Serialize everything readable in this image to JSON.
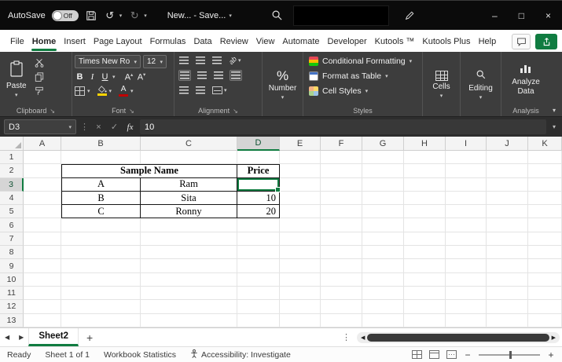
{
  "glyphs": {
    "chevron_down": "▾",
    "tri_up": "▴",
    "launcher": "↘",
    "undo": "↺",
    "redo": "↻",
    "minimize": "–",
    "maximize": "□",
    "close": "×",
    "dots_vertical": "⋮",
    "cancel": "×",
    "check": "✓",
    "fx": "fx",
    "prev": "◀",
    "next": "▶",
    "add": "+",
    "percent": "%",
    "bold": "B",
    "italic": "I",
    "underline": "U",
    "font_a": "A",
    "ab": "ab",
    "minus": "−",
    "plus": "+"
  },
  "titlebar": {
    "autosave_label": "AutoSave",
    "autosave_state": "Off",
    "filename": "New... - Save..."
  },
  "tabs": {
    "items": [
      "File",
      "Home",
      "Insert",
      "Page Layout",
      "Formulas",
      "Data",
      "Review",
      "View",
      "Automate",
      "Developer",
      "Kutools ™",
      "Kutools Plus",
      "Help"
    ],
    "active": "Home"
  },
  "ribbon": {
    "clipboard": {
      "paste_label": "Paste",
      "group_label": "Clipboard"
    },
    "font": {
      "name": "Times New Ro",
      "size": "12",
      "group_label": "Font"
    },
    "alignment": {
      "group_label": "Alignment"
    },
    "number": {
      "label": "Number"
    },
    "styles": {
      "conditional": "Conditional Formatting",
      "format_table": "Format as Table",
      "cell_styles": "Cell Styles",
      "group_label": "Styles"
    },
    "cells": {
      "label": "Cells"
    },
    "editing": {
      "label": "Editing"
    },
    "analysis": {
      "button_label": "Analyze Data",
      "group_label": "Analysis"
    }
  },
  "formula_bar": {
    "name_box": "D3",
    "value": "10"
  },
  "grid": {
    "columns": [
      "A",
      "B",
      "C",
      "D",
      "E",
      "F",
      "G",
      "H",
      "I",
      "J",
      "K"
    ],
    "rows": [
      1,
      2,
      3,
      4,
      5,
      6,
      7,
      8,
      9,
      10,
      11,
      12,
      13
    ],
    "selected_column": "D",
    "selected_row": 3,
    "active_cell": "D3",
    "cells": {
      "B2": {
        "v": "Sample Name",
        "bold": true,
        "merge": 2
      },
      "D2": {
        "v": "Price",
        "bold": true
      },
      "B3": {
        "v": "A"
      },
      "C3": {
        "v": "Ram"
      },
      "D3": {
        "v": ""
      },
      "B4": {
        "v": "B"
      },
      "C4": {
        "v": "Sita"
      },
      "D4": {
        "v": "10",
        "align": "right"
      },
      "B5": {
        "v": "C"
      },
      "C5": {
        "v": "Ronny"
      },
      "D5": {
        "v": "20",
        "align": "right"
      }
    },
    "bordered_range": {
      "cols": [
        "B",
        "C",
        "D"
      ],
      "rows": [
        2,
        3,
        4,
        5
      ]
    }
  },
  "sheet_bar": {
    "active_tab": "Sheet2"
  },
  "status_bar": {
    "mode": "Ready",
    "sheet_info": "Sheet 1 of 1",
    "workbook_stats": "Workbook Statistics",
    "accessibility": "Accessibility: Investigate"
  }
}
